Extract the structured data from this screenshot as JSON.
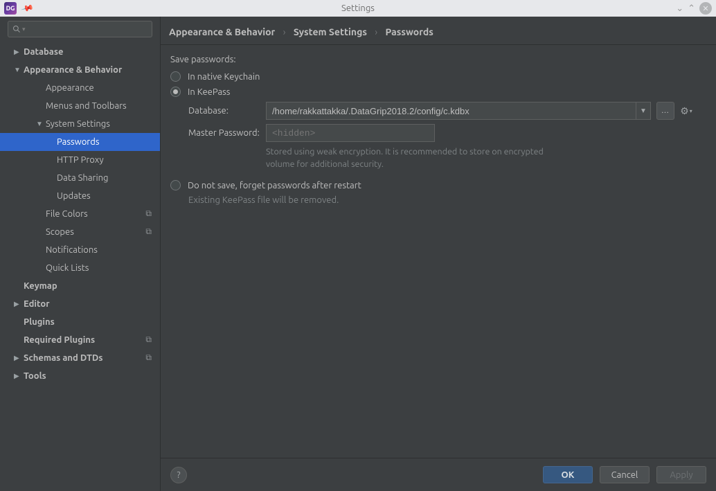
{
  "titlebar": {
    "title": "Settings"
  },
  "search": {
    "placeholder": ""
  },
  "tree": {
    "database": "Database",
    "appearance_behavior": "Appearance & Behavior",
    "appearance": "Appearance",
    "menus_toolbars": "Menus and Toolbars",
    "system_settings": "System Settings",
    "passwords": "Passwords",
    "http_proxy": "HTTP Proxy",
    "data_sharing": "Data Sharing",
    "updates": "Updates",
    "file_colors": "File Colors",
    "scopes": "Scopes",
    "notifications": "Notifications",
    "quick_lists": "Quick Lists",
    "keymap": "Keymap",
    "editor": "Editor",
    "plugins": "Plugins",
    "required_plugins": "Required Plugins",
    "schemas_dtds": "Schemas and DTDs",
    "tools": "Tools"
  },
  "breadcrumb": {
    "a": "Appearance & Behavior",
    "b": "System Settings",
    "c": "Passwords"
  },
  "form": {
    "save_passwords": "Save passwords:",
    "opt_native": "In native Keychain",
    "opt_keepass": "In KeePass",
    "db_label": "Database:",
    "db_value": "/home/rakkattakka/.DataGrip2018.2/config/c.kdbx",
    "mp_label": "Master Password:",
    "mp_placeholder": "<hidden>",
    "mp_hint": "Stored using weak encryption. It is recommended to store on encrypted volume for additional security.",
    "opt_dont_save": "Do not save, forget passwords after restart",
    "dont_save_note": "Existing KeePass file will be removed."
  },
  "footer": {
    "ok": "OK",
    "cancel": "Cancel",
    "apply": "Apply"
  }
}
